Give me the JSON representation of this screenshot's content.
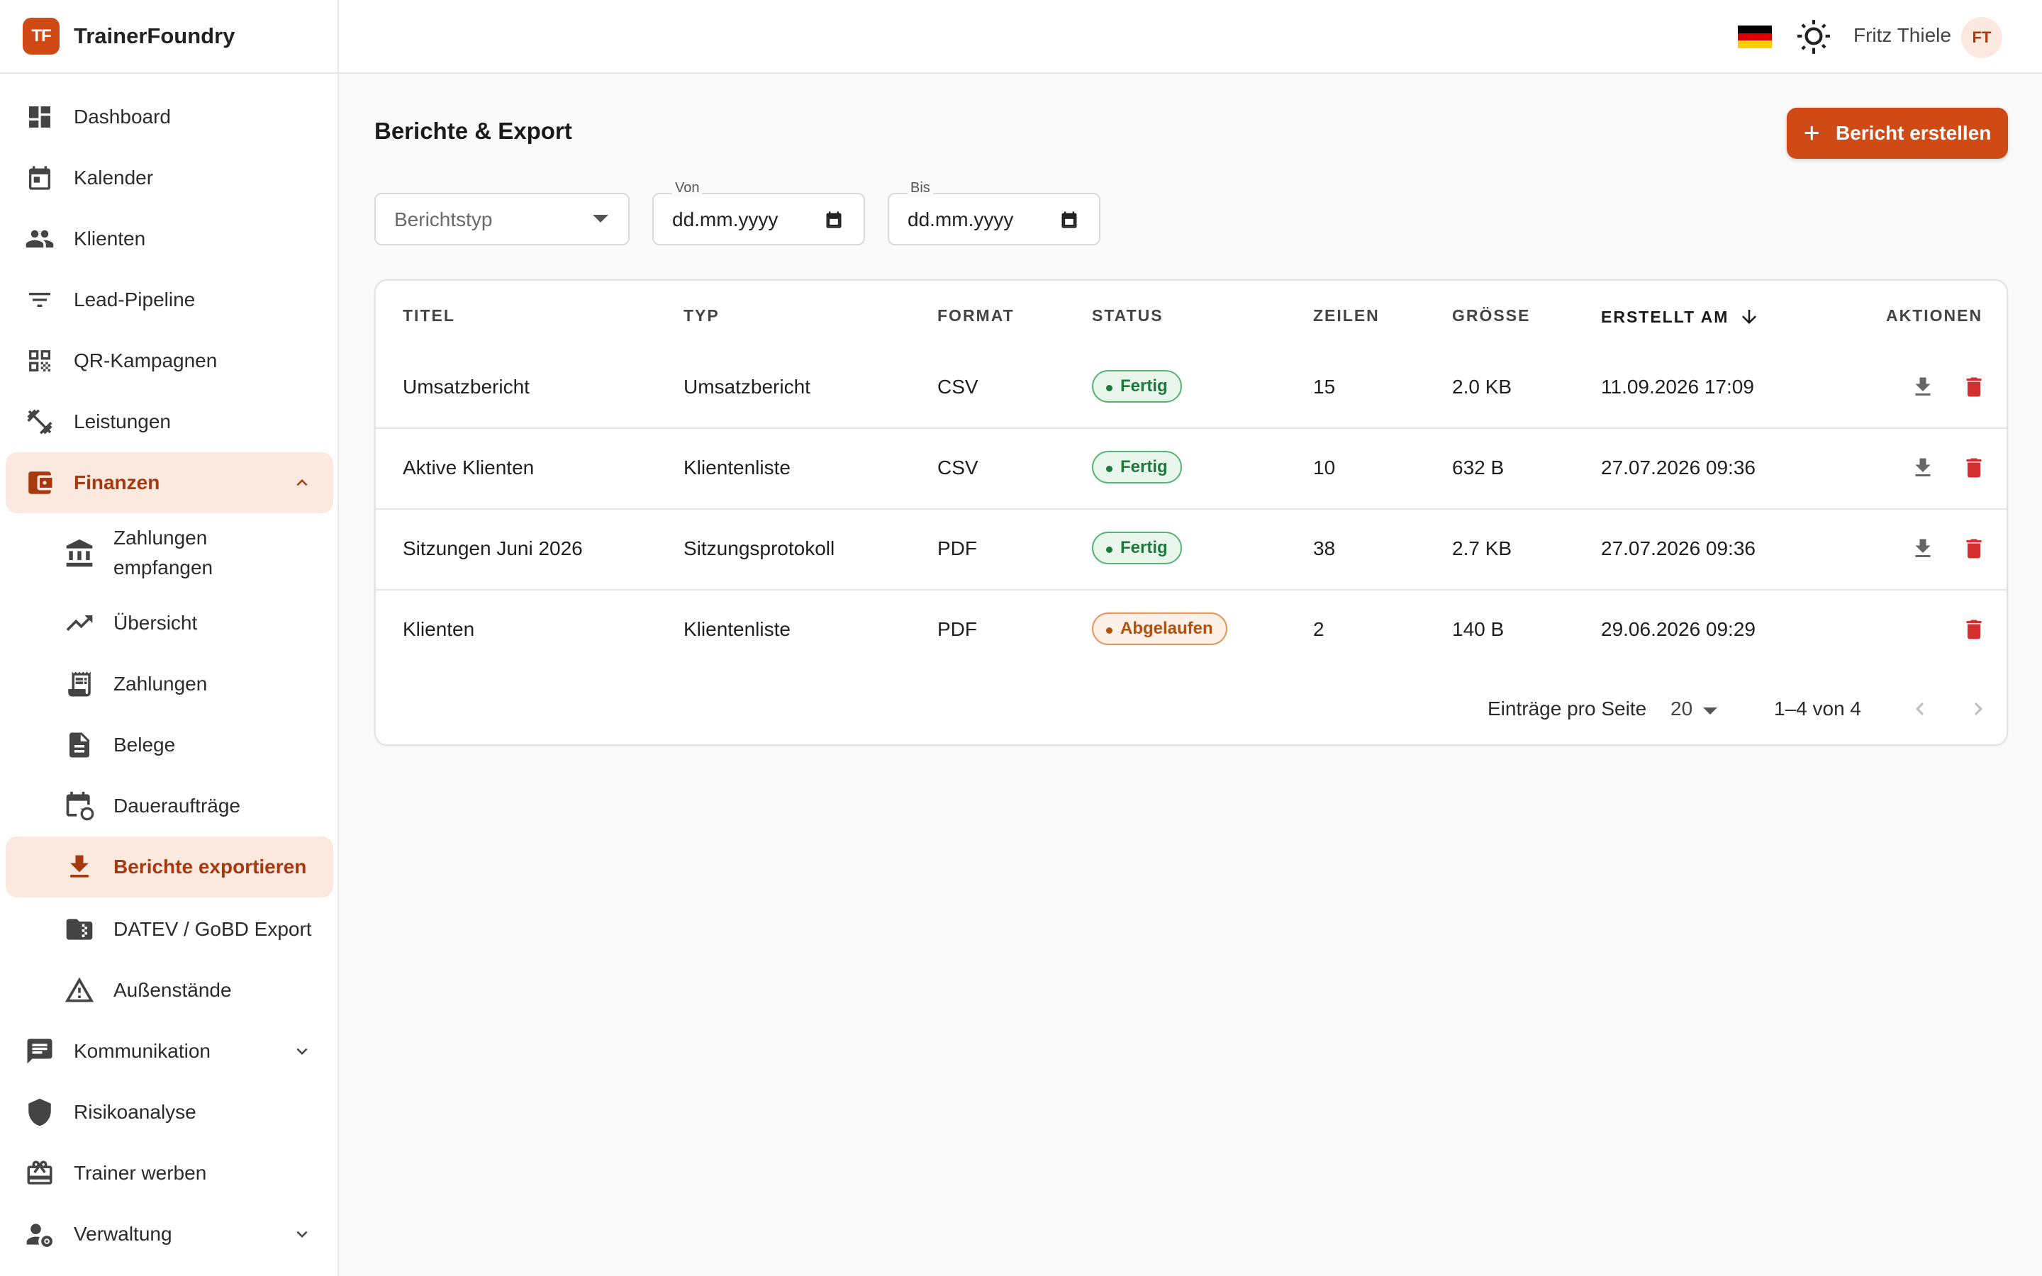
{
  "app": {
    "brand_logo": "TF",
    "brand_name": "TrainerFoundry",
    "accent_color": "#cf4a15"
  },
  "topbar": {
    "language_flag": "flag-de-icon",
    "theme_icon": "sun-icon",
    "user_name": "Fritz Thiele",
    "user_initials": "FT"
  },
  "sidebar": {
    "items": [
      {
        "label": "Dashboard",
        "icon": "dashboard-icon"
      },
      {
        "label": "Kalender",
        "icon": "calendar-icon"
      },
      {
        "label": "Klienten",
        "icon": "people-icon"
      },
      {
        "label": "Lead-Pipeline",
        "icon": "filter-icon"
      },
      {
        "label": "QR-Kampagnen",
        "icon": "qr-code-icon"
      },
      {
        "label": "Leistungen",
        "icon": "dumbbell-icon"
      },
      {
        "label": "Finanzen",
        "icon": "wallet-icon",
        "expanded": true
      },
      {
        "label": "Kommunikation",
        "icon": "chat-icon"
      },
      {
        "label": "Risikoanalyse",
        "icon": "shield-icon"
      },
      {
        "label": "Trainer werben",
        "icon": "gift-icon"
      },
      {
        "label": "Verwaltung",
        "icon": "user-settings-icon"
      }
    ],
    "finance_subitems": [
      {
        "label_line1": "Zahlungen",
        "label_line2": "empfangen",
        "icon": "bank-icon"
      },
      {
        "label": "Übersicht",
        "icon": "trending-up-icon"
      },
      {
        "label": "Zahlungen",
        "icon": "receipt-icon"
      },
      {
        "label": "Belege",
        "icon": "document-icon"
      },
      {
        "label": "Daueraufträge",
        "icon": "calendar-repeat-icon"
      },
      {
        "label": "Berichte exportieren",
        "icon": "download-icon",
        "active": true
      },
      {
        "label": "DATEV / GoBD Export",
        "icon": "zip-folder-icon"
      },
      {
        "label": "Außenstände",
        "icon": "warning-icon"
      }
    ]
  },
  "main": {
    "title": "Berichte & Export",
    "create_button": "Bericht erstellen",
    "filters": {
      "report_type_placeholder": "Berichtstyp",
      "from_label": "Von",
      "from_value": "dd.mm.yyyy",
      "to_label": "Bis",
      "to_value": "dd.mm.yyyy"
    },
    "table": {
      "columns": [
        "TITEL",
        "TYP",
        "FORMAT",
        "STATUS",
        "ZEILEN",
        "GRÖSSE",
        "ERSTELLT AM",
        "AKTIONEN"
      ],
      "rows": [
        {
          "title": "Umsatzbericht",
          "type": "Umsatzbericht",
          "format": "CSV",
          "status": "Fertig",
          "status_kind": "ok",
          "rows": "15",
          "size": "2.0 KB",
          "created": "11.09.2026 17:09",
          "downloadable": true
        },
        {
          "title": "Aktive Klienten",
          "type": "Klientenliste",
          "format": "CSV",
          "status": "Fertig",
          "status_kind": "ok",
          "rows": "10",
          "size": "632 B",
          "created": "27.07.2026 09:36",
          "downloadable": true
        },
        {
          "title": "Sitzungen Juni 2026",
          "type": "Sitzungsprotokoll",
          "format": "PDF",
          "status": "Fertig",
          "status_kind": "ok",
          "rows": "38",
          "size": "2.7 KB",
          "created": "27.07.2026 09:36",
          "downloadable": true
        },
        {
          "title": "Klienten",
          "type": "Klientenliste",
          "format": "PDF",
          "status": "Abgelaufen",
          "status_kind": "expired",
          "rows": "2",
          "size": "140 B",
          "created": "29.06.2026 09:29",
          "downloadable": false
        }
      ]
    },
    "pagination": {
      "per_page_label": "Einträge pro Seite",
      "per_page_value": "20",
      "range": "1–4 von 4"
    }
  },
  "colors": {
    "status_ok": "#1e7a3c",
    "status_expired": "#b2500f",
    "delete": "#d32f2f"
  }
}
